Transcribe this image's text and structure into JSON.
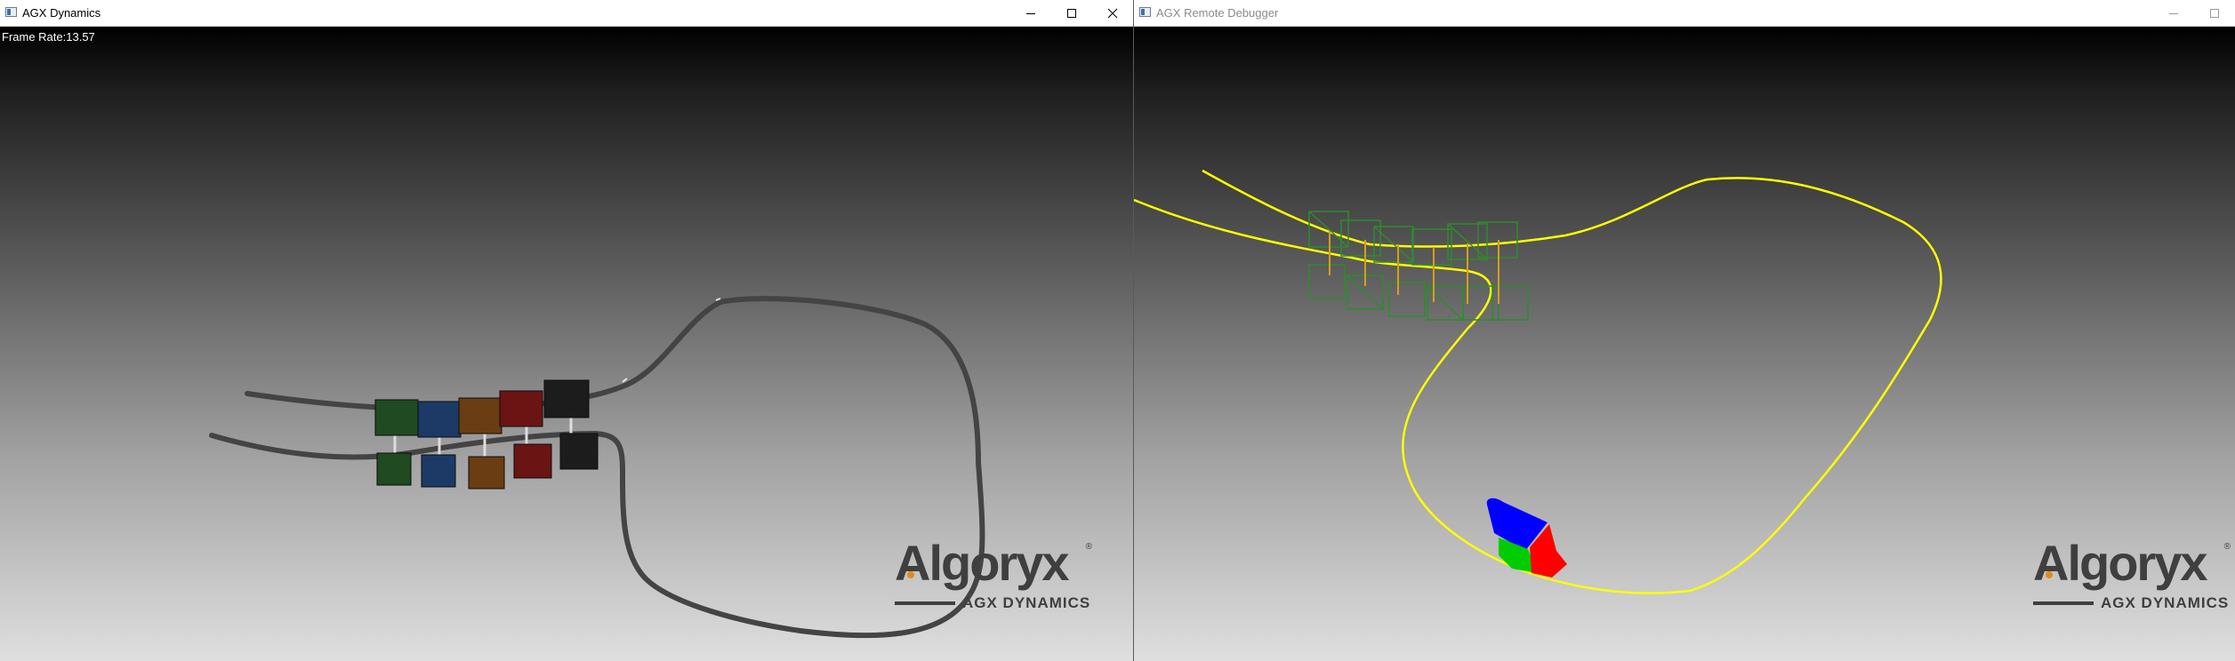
{
  "left_window": {
    "title": "AGX Dynamics",
    "frame_rate_label": "Frame Rate:13.57",
    "controls": [
      "minimize",
      "maximize",
      "close"
    ],
    "logo": {
      "wordmark": "Algoryx",
      "tagline": "AGX DYNAMICS",
      "mark": "®"
    },
    "colors": {
      "rope": "#444444",
      "boxes": [
        "#1f4a22",
        "#1d3a66",
        "#6a3d12",
        "#6b1414",
        "#1c1c1c"
      ]
    }
  },
  "right_window": {
    "title": "AGX Remote Debugger",
    "controls": [
      "minimize",
      "maximize"
    ],
    "logo": {
      "wordmark": "Algoryx",
      "tagline": "AGX DYNAMICS",
      "mark": "®"
    },
    "colors": {
      "rope": "#ffff00",
      "wireframe": "#2e8b2e",
      "axes": [
        "#0000ff",
        "#00cc00",
        "#ff0000"
      ]
    }
  }
}
